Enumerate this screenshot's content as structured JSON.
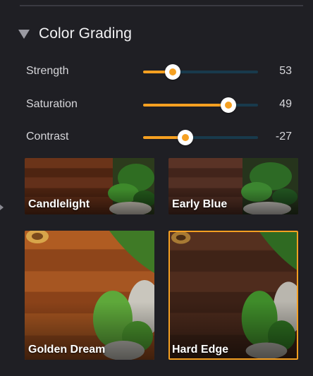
{
  "section": {
    "title": "Color Grading",
    "expanded": true
  },
  "sliders": [
    {
      "label": "Strength",
      "value": "53",
      "fraction": 0.26
    },
    {
      "label": "Saturation",
      "value": "49",
      "fraction": 0.74
    },
    {
      "label": "Contrast",
      "value": "-27",
      "fraction": 0.37
    }
  ],
  "presets": [
    {
      "label": "Candlelight",
      "selected": false
    },
    {
      "label": "Early Blue",
      "selected": false
    },
    {
      "label": "Golden Dream",
      "selected": false
    },
    {
      "label": "Hard Edge",
      "selected": true
    }
  ],
  "colors": {
    "accent": "#f5a021",
    "track": "#183a4c",
    "background": "#1f1f24"
  }
}
